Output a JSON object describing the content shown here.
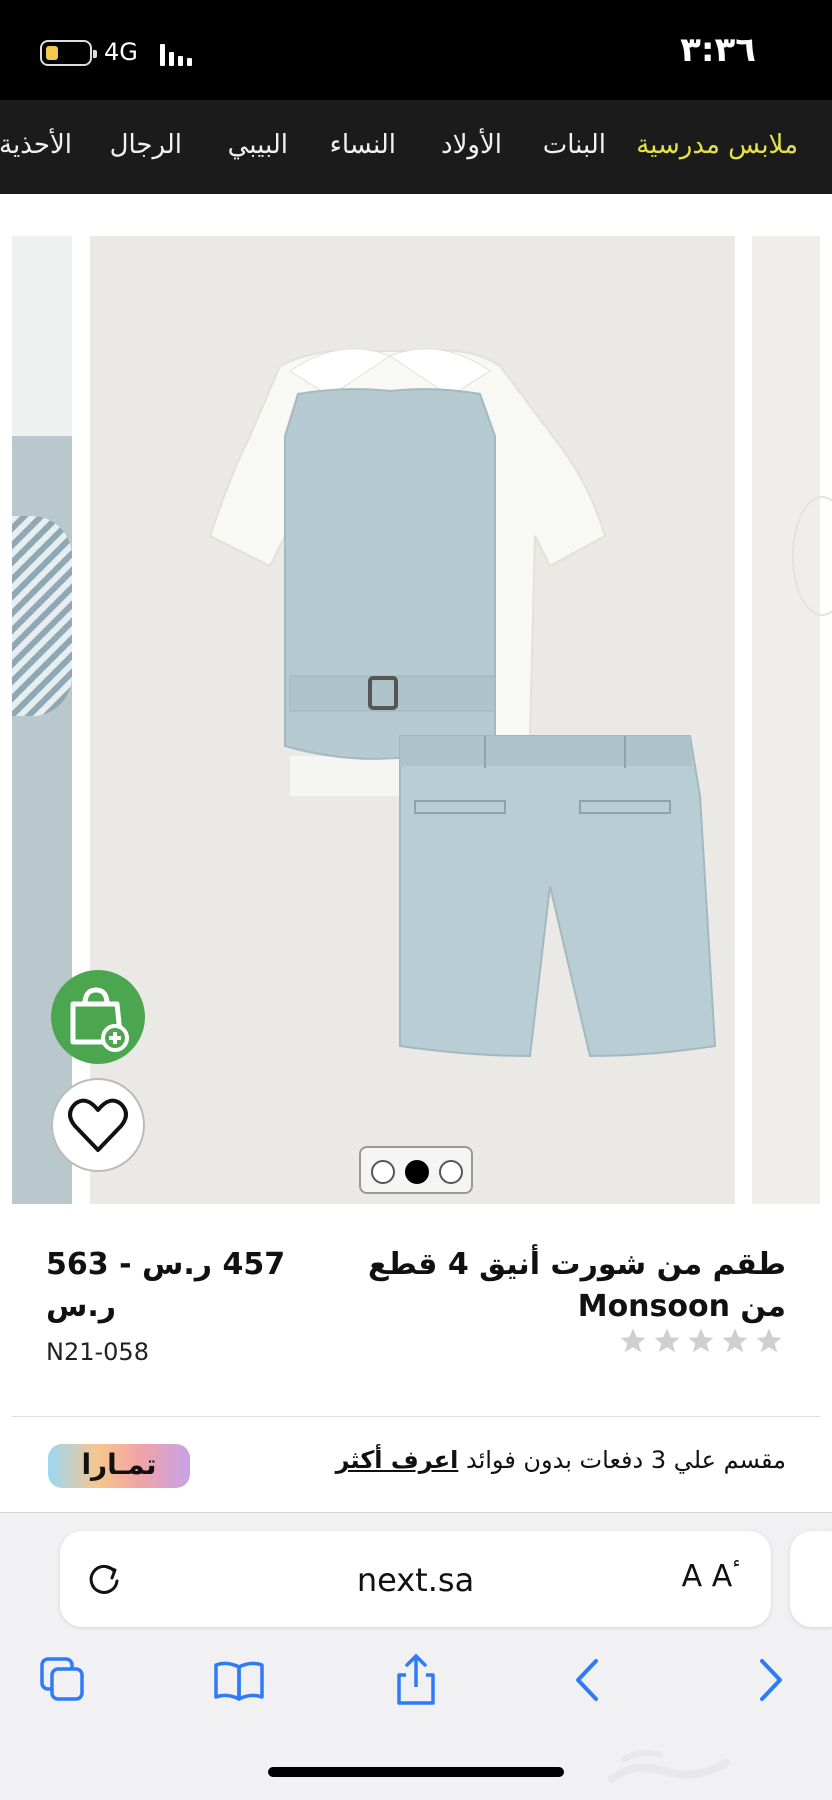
{
  "status_bar": {
    "network": "4G",
    "time": "٣:٣٦"
  },
  "categories": [
    {
      "label": "ملابس مدرسية",
      "active": true
    },
    {
      "label": "البنات",
      "active": false
    },
    {
      "label": "الأولاد",
      "active": false
    },
    {
      "label": "النساء",
      "active": false
    },
    {
      "label": "البيبي",
      "active": false
    },
    {
      "label": "الرجال",
      "active": false
    },
    {
      "label": "الأحذية",
      "active": false
    }
  ],
  "product": {
    "title": "طقم من شورت أنيق 4 قطع من Monsoon",
    "price": "457 ر.س - 563 ر.س",
    "sku": "N21-058",
    "rating": 0,
    "rating_max": 5,
    "image_page": 2,
    "image_count": 3
  },
  "installments": {
    "text": "مقسم علي 3 دفعات بدون فوائد",
    "learn_more": "اعرف أكثر",
    "provider_label": "تمـارا"
  },
  "browser": {
    "url": "next.sa",
    "text_size_label": "ٴA A"
  },
  "icons": {
    "bag": "add-to-bag-icon",
    "heart": "heart-icon",
    "reload": "reload-icon",
    "tabs": "tabs-icon",
    "bookmarks": "bookmarks-icon",
    "share": "share-icon",
    "back": "back-icon",
    "forward": "forward-icon",
    "star": "star-icon"
  },
  "colors": {
    "nav_active": "#e4e14a",
    "bag_button": "#4ca64f",
    "garment": "#b5cbd1",
    "browser_blue": "#2f7bf5"
  }
}
